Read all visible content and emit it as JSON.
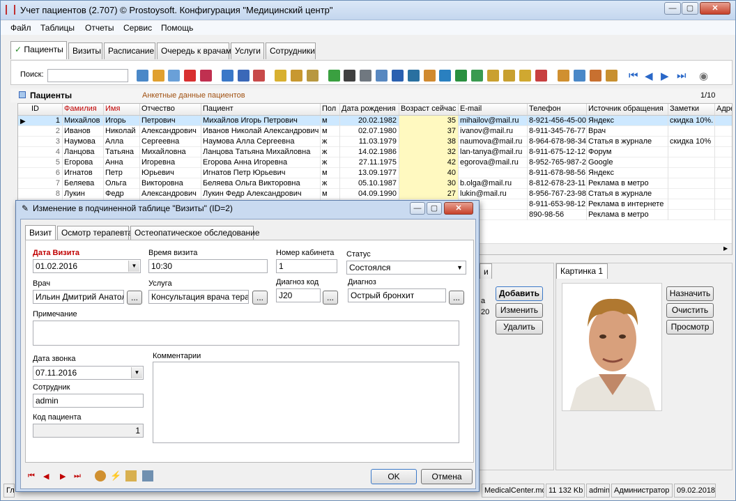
{
  "app": {
    "title": "Учет пациентов (2.707) © Prostoysoft. Конфигурация \"Медицинский центр\"",
    "menu": [
      "Файл",
      "Таблицы",
      "Отчеты",
      "Сервис",
      "Помощь"
    ]
  },
  "main_tabs": [
    "Пациенты",
    "Визиты",
    "Расписание",
    "Очередь к врачам",
    "Услуги",
    "Сотрудники"
  ],
  "toolbar": {
    "search_label": "Поиск:",
    "search_value": ""
  },
  "panel": {
    "title": "Пациенты",
    "subtitle": "Анкетные данные пациентов",
    "counter": "1/10"
  },
  "table": {
    "columns": [
      "ID",
      "Фамилия",
      "Имя",
      "Отчество",
      "Пациент",
      "Пол",
      "Дата рождения",
      "Возраст сейчас",
      "E-mail",
      "Телефон",
      "Источник обращения",
      "Заметки",
      "Адрес"
    ],
    "rows": [
      [
        "1",
        "Михайлов",
        "Игорь",
        "Петрович",
        "Михайлов Игорь Петрович",
        "м",
        "20.02.1982",
        "35",
        "mihailov@mail.ru",
        "8-921-456-45-00",
        "Яндекс",
        "скидка 10%."
      ],
      [
        "2",
        "Иванов",
        "Николай",
        "Александрович",
        "Иванов Николай Александрович",
        "м",
        "02.07.1980",
        "37",
        "ivanov@mail.ru",
        "8-911-345-76-77",
        "Врач",
        ""
      ],
      [
        "3",
        "Наумова",
        "Алла",
        "Сергеевна",
        "Наумова Алла Сергеевна",
        "ж",
        "11.03.1979",
        "38",
        "naumova@mail.ru",
        "8-964-678-98-34",
        "Статья в журнале",
        "скидка 10%"
      ],
      [
        "4",
        "Ланцова",
        "Татьяна",
        "Михайловна",
        "Ланцова Татьяна Михайловна",
        "ж",
        "14.02.1986",
        "32",
        "lan-tanya@mail.ru",
        "8-911-675-12-12",
        "Форум",
        ""
      ],
      [
        "5",
        "Егорова",
        "Анна",
        "Игоревна",
        "Егорова Анна Игоревна",
        "ж",
        "27.11.1975",
        "42",
        "egorova@mail.ru",
        "8-952-765-987-2",
        "Google",
        ""
      ],
      [
        "6",
        "Игнатов",
        "Петр",
        "Юрьевич",
        "Игнатов  Петр Юрьевич",
        "м",
        "13.09.1977",
        "40",
        "",
        "8-911-678-98-56",
        "Яндекс",
        ""
      ],
      [
        "7",
        "Беляева",
        "Ольга",
        "Викторовна",
        "Беляева  Ольга Викторовна",
        "ж",
        "05.10.1987",
        "30",
        "b.olga@mail.ru",
        "8-812-678-23-11",
        "Реклама в метро",
        ""
      ],
      [
        "8",
        "Лукин",
        "Федр",
        "Александрович",
        "Лукин Федр Александрович",
        "м",
        "04.09.1990",
        "27",
        "lukin@mail.ru",
        "8-956-767-23-98",
        "Статья в журнале",
        ""
      ],
      [
        "",
        "",
        "",
        "",
        "",
        "",
        "",
        "",
        "il.ru",
        "8-911-653-98-12",
        "Реклама в интернете",
        ""
      ],
      [
        "",
        "",
        "",
        "",
        "",
        "",
        "",
        "",
        "",
        "890-98-56",
        "Реклама в метро",
        ""
      ]
    ]
  },
  "right_panel": {
    "partial_tab": "и",
    "add": "Добавить",
    "edit": "Изменить",
    "delete": "Удалить",
    "partial_text1": "а",
    "partial_text2": "20",
    "picture_tab": "Картинка 1",
    "assign": "Назначить",
    "clear": "Очистить",
    "view": "Просмотр"
  },
  "status": {
    "file": "MedicalCenter.mdb",
    "size": "11 132 Kb",
    "user": "admin",
    "role": "Администратор",
    "date": "09.02.2018",
    "left": "Гл"
  },
  "dialog": {
    "title": "Изменение в подчиненной таблице \"Визиты\" (ID=2)",
    "tabs": [
      "Визит",
      "Осмотр терапевта",
      "Остеопатическое обследование"
    ],
    "visit_date_label": "Дата Визита",
    "visit_date": "01.02.2016",
    "visit_time_label": "Время визита",
    "visit_time": "10:30",
    "room_label": "Номер кабинета",
    "room": "1",
    "status_label": "Статус",
    "status": "Состоялся",
    "doctor_label": "Врач",
    "doctor": "Ильин Дмитрий Анатоль",
    "service_label": "Услуга",
    "service": "Консультация врача терапе",
    "diag_code_label": "Диагноз код",
    "diag_code": "J20",
    "diag_label": "Диагноз",
    "diag": "Острый бронхит",
    "note_label": "Примечание",
    "note": "",
    "call_date_label": "Дата звонка",
    "call_date": "07.11.2016",
    "comments_label": "Комментарии",
    "comments": "",
    "employee_label": "Сотрудник",
    "employee": "admin",
    "patient_code_label": "Код пациента",
    "patient_code": "1",
    "ok": "OK",
    "cancel": "Отмена",
    "ellipsis": "..."
  },
  "colors": {
    "accent_red": "#c00000",
    "highlight": "#fff9c0",
    "selected_row": "#cde8ff"
  }
}
